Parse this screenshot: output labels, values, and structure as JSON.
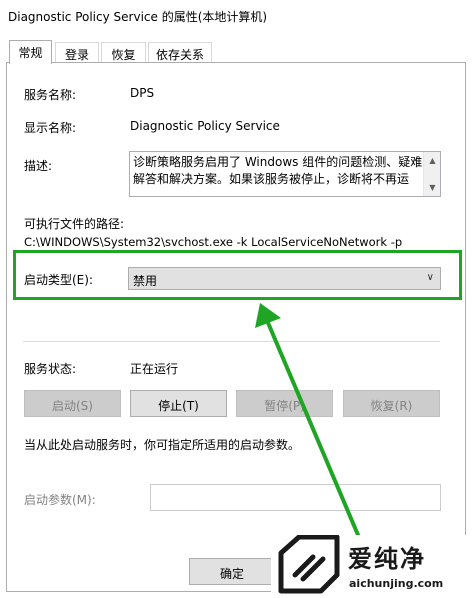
{
  "window": {
    "title": "Diagnostic Policy Service 的属性(本地计算机)"
  },
  "tabs": [
    {
      "label": "常规",
      "active": true
    },
    {
      "label": "登录",
      "active": false
    },
    {
      "label": "恢复",
      "active": false
    },
    {
      "label": "依存关系",
      "active": false
    }
  ],
  "general": {
    "service_name_label": "服务名称:",
    "service_name_value": "DPS",
    "display_name_label": "显示名称:",
    "display_name_value": "Diagnostic Policy Service",
    "description_label": "描述:",
    "description_value": "诊断策略服务启用了 Windows 组件的问题检测、疑难解答和解决方案。如果该服务被停止，诊断将不再运",
    "exe_path_label": "可执行文件的路径:",
    "exe_path_value": "C:\\WINDOWS\\System32\\svchost.exe -k LocalServiceNoNetwork -p",
    "startup_type_label": "启动类型(E):",
    "startup_type_value": "禁用",
    "service_status_label": "服务状态:",
    "service_status_value": "正在运行",
    "buttons": {
      "start": "启动(S)",
      "stop": "停止(T)",
      "pause": "暂停(P)",
      "resume": "恢复(R)"
    },
    "hint_text": "当从此处启动服务时，你可指定所适用的启动参数。",
    "start_params_label": "启动参数(M):",
    "start_params_value": ""
  },
  "footer": {
    "ok_label": "确定"
  },
  "watermark": {
    "brand": "爱纯净",
    "url": "aichunjing.com"
  },
  "colors": {
    "highlight_green": "#1fa524"
  }
}
